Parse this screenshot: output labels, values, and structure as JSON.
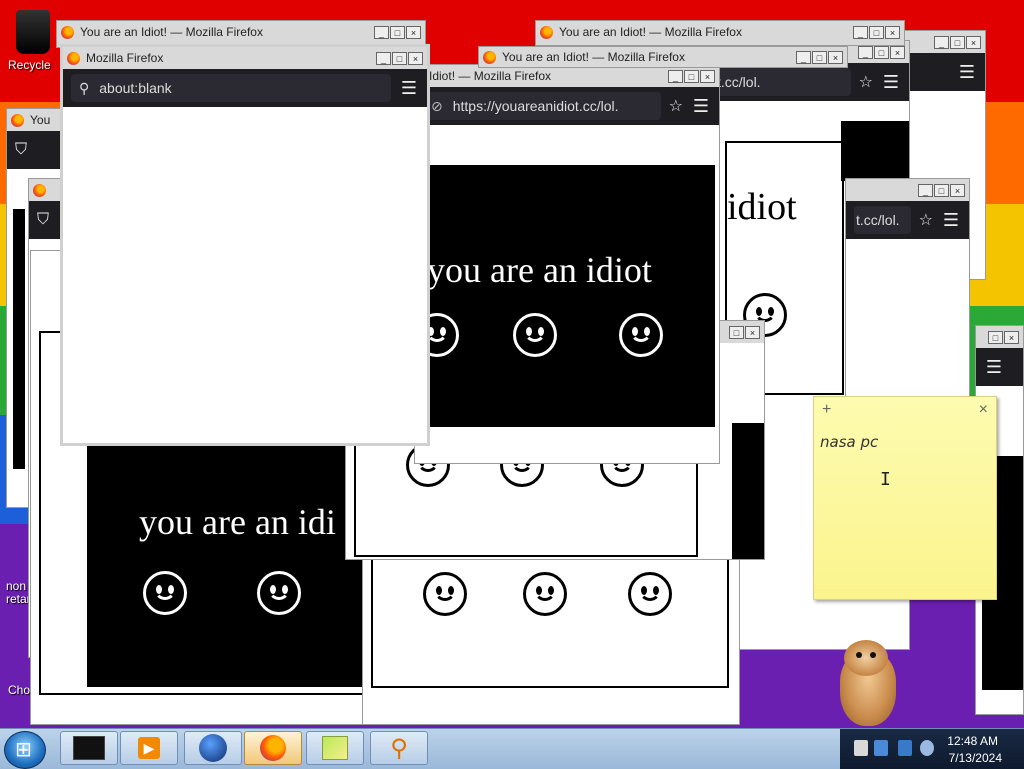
{
  "desktop": {
    "icons": [
      {
        "label": "Recycle"
      },
      {
        "label": "non\nretar"
      },
      {
        "label": "Cho"
      }
    ]
  },
  "browser": {
    "window_title": "You are an Idiot! — Mozilla Firefox",
    "window_title_short": "You are an Idiot! — Mozilla Firefox",
    "window_title_partial": "n Idiot! — Mozilla Firefox",
    "window_title_blank": "Mozilla Firefox",
    "window_title_tiny": "You",
    "url_blank": "about:blank",
    "url_site": "https://youareanidiot.cc/lol.",
    "url_partial": "t.cc/lol.",
    "url_partial2": "t.cc/lol.",
    "page_text": "you are an idiot",
    "page_text_partial": "you are an idi",
    "page_text_right": "idiot",
    "menu_icon": "hamburger-menu-icon",
    "caption_buttons": [
      "_",
      "□",
      "×"
    ]
  },
  "sticky_note": {
    "text": "nasa pc",
    "add_symbol": "+",
    "close_symbol": "×"
  },
  "taskbar": {
    "time": "12:48 AM",
    "date": "7/13/2024",
    "pinned": [
      "cmd-icon",
      "media-player-icon",
      "globe-icon",
      "firefox-icon",
      "sticky-notes-icon",
      "magnifier-icon"
    ]
  },
  "colors": {
    "titlebar": "#d9d9d9",
    "navbar": "#1e1e22",
    "taskbar": "#bcd3ea",
    "sticky": "#fbf48d"
  }
}
